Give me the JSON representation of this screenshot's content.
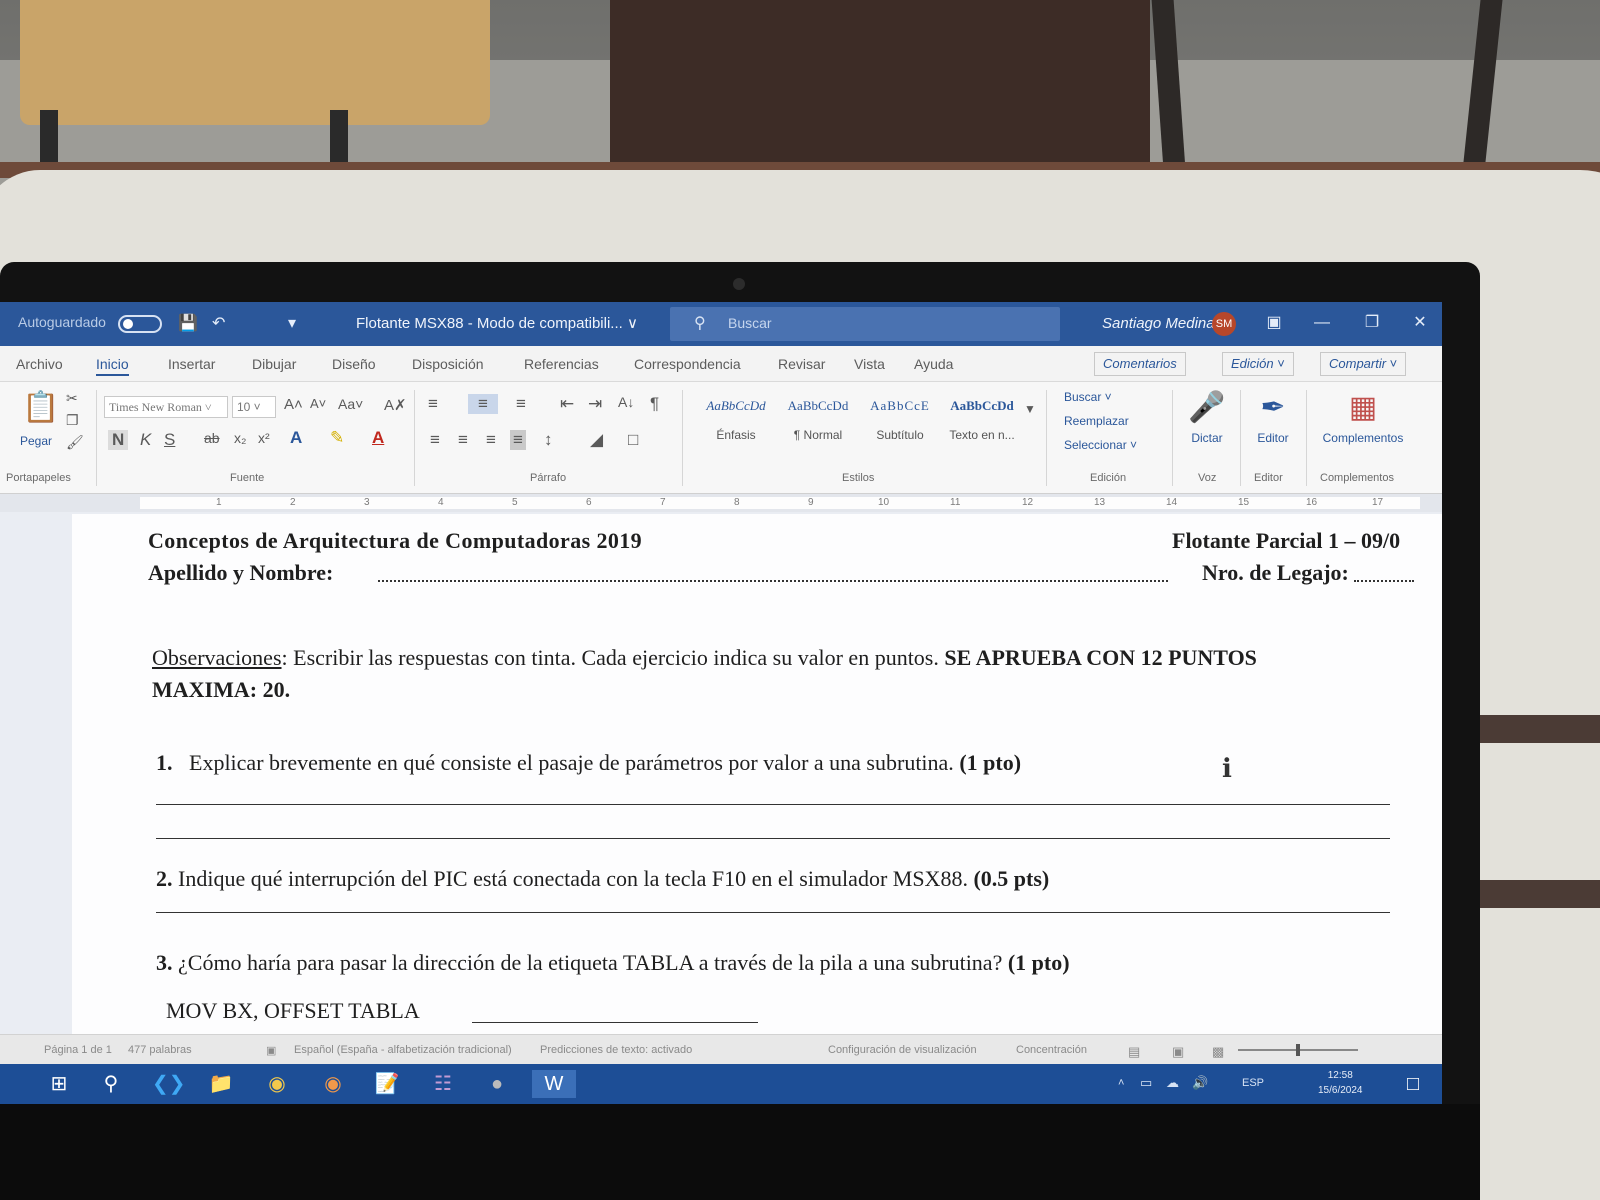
{
  "window": {
    "autosave_label": "Autoguardado",
    "doc_title": "Flotante MSX88 - Modo de compatibili... ∨",
    "search_placeholder": "Buscar",
    "user_name": "Santiago Medina",
    "user_initials": "SM",
    "controls": {
      "ribbon_display": "▣",
      "minimize": "—",
      "restore": "❐",
      "close": "✕"
    }
  },
  "ribbon_tabs": [
    "Archivo",
    "Inicio",
    "Insertar",
    "Dibujar",
    "Diseño",
    "Disposición",
    "Referencias",
    "Correspondencia",
    "Revisar",
    "Vista",
    "Ayuda"
  ],
  "ribbon_tab_active": "Inicio",
  "ribbon_right": {
    "comments": "Comentarios",
    "editing": "Edición ˅",
    "share": "Compartir ˅"
  },
  "ribbon": {
    "clipboard": {
      "paste": "Pegar",
      "label": "Portapapeles"
    },
    "font": {
      "family": "Times New Roman ˅",
      "size": "10 ˅",
      "bold": "N",
      "italic": "K",
      "underline": "S",
      "label": "Fuente"
    },
    "paragraph": {
      "label": "Párrafo"
    },
    "styles": {
      "items": [
        {
          "sample": "AaBbCcDd",
          "name": "Énfasis"
        },
        {
          "sample": "AaBbCcDd",
          "name": "¶ Normal"
        },
        {
          "sample": "AaBbCcE",
          "name": "Subtítulo"
        },
        {
          "sample": "AaBbCcDd",
          "name": "Texto en n..."
        }
      ],
      "label": "Estilos"
    },
    "editing": {
      "find": "Buscar ˅",
      "replace": "Reemplazar",
      "select": "Seleccionar ˅",
      "label": "Edición"
    },
    "voice": {
      "dictate": "Dictar",
      "label": "Voz"
    },
    "editor": {
      "editor": "Editor",
      "label": "Editor"
    },
    "addins": {
      "addins": "Complementos",
      "label": "Complementos"
    }
  },
  "ruler_numbers": [
    "1",
    "2",
    "3",
    "4",
    "5",
    "6",
    "7",
    "8",
    "9",
    "10",
    "11",
    "12",
    "13",
    "14",
    "15",
    "16",
    "17"
  ],
  "document": {
    "header_title": "Conceptos de Arquitectura de Computadoras 2019",
    "header_right": "Flotante Parcial 1 – 09/0",
    "name_label": "Apellido y Nombre:",
    "legajo_label": "Nro. de Legajo:",
    "obs_title": "Observaciones",
    "obs_text": ": Escribir las respuestas con tinta. Cada ejercicio indica su valor en puntos. ",
    "obs_bold": "SE APRUEBA CON 12 PUNTOS",
    "obs_bold2": "MAXIMA: 20.",
    "questions": [
      {
        "number": "1.",
        "text": "Explicar brevemente en qué consiste el pasaje de parámetros por valor a una subrutina.",
        "points": "(1 pto)"
      },
      {
        "number": "2.",
        "text": "Indique qué interrupción del PIC está conectada con la tecla F10 en el simulador MSX88.",
        "points": "(0.5 pts)"
      },
      {
        "number": "3.",
        "text": "¿Cómo haría para pasar la dirección de la etiqueta TABLA a través de la pila a una subrutina?",
        "points": "(1 pto)"
      }
    ],
    "answer_3": "MOV BX, OFFSET TABLA"
  },
  "status_bar": {
    "page": "Página 1 de 1",
    "words": "477 palabras",
    "language": "Español (España - alfabetización tradicional)",
    "predictions": "Predicciones de texto: activado",
    "display_settings": "Configuración de visualización",
    "focus": "Concentración"
  },
  "taskbar": {
    "language": "ESP",
    "time": "12:58",
    "date": "15/6/2024"
  },
  "colors": {
    "word_blue": "#2b579a",
    "taskbar_blue": "#1d4e96"
  }
}
